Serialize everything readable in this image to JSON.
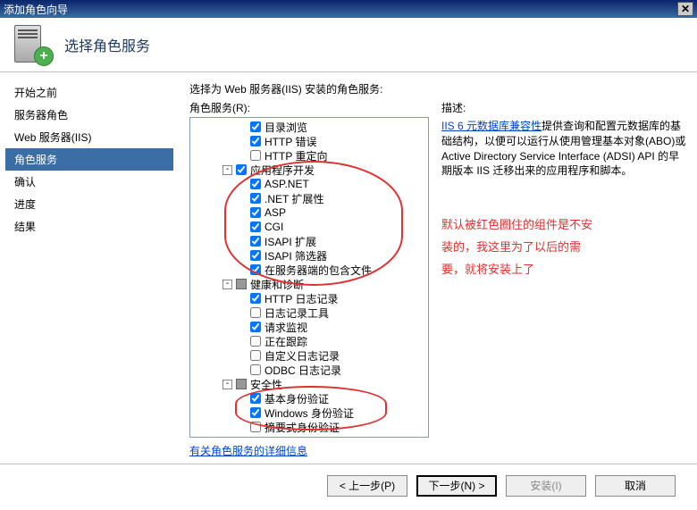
{
  "window": {
    "title": "添加角色向导",
    "close_glyph": "✕"
  },
  "header": {
    "title": "选择角色服务"
  },
  "nav": {
    "items": [
      {
        "label": "开始之前"
      },
      {
        "label": "服务器角色"
      },
      {
        "label": "Web 服务器(IIS)"
      },
      {
        "label": "角色服务",
        "active": true
      },
      {
        "label": "确认"
      },
      {
        "label": "进度"
      },
      {
        "label": "结果"
      }
    ]
  },
  "main": {
    "prompt": "选择为 Web 服务器(IIS) 安装的角色服务:",
    "role_label": "角色服务(R):",
    "tree": [
      {
        "indent": 3,
        "exp": "",
        "chk": "checked",
        "label": "目录浏览"
      },
      {
        "indent": 3,
        "exp": "",
        "chk": "checked",
        "label": "HTTP 错误"
      },
      {
        "indent": 3,
        "exp": "",
        "chk": "unchecked",
        "label": "HTTP 重定向"
      },
      {
        "indent": 2,
        "exp": "-",
        "chk": "checked",
        "label": "应用程序开发"
      },
      {
        "indent": 3,
        "exp": "",
        "chk": "checked",
        "label": "ASP.NET"
      },
      {
        "indent": 3,
        "exp": "",
        "chk": "checked",
        "label": ".NET 扩展性"
      },
      {
        "indent": 3,
        "exp": "",
        "chk": "checked",
        "label": "ASP"
      },
      {
        "indent": 3,
        "exp": "",
        "chk": "checked",
        "label": "CGI"
      },
      {
        "indent": 3,
        "exp": "",
        "chk": "checked",
        "label": "ISAPI 扩展"
      },
      {
        "indent": 3,
        "exp": "",
        "chk": "checked",
        "label": "ISAPI 筛选器"
      },
      {
        "indent": 3,
        "exp": "",
        "chk": "checked",
        "label": "在服务器端的包含文件"
      },
      {
        "indent": 2,
        "exp": "-",
        "chk": "tri",
        "label": "健康和诊断"
      },
      {
        "indent": 3,
        "exp": "",
        "chk": "checked",
        "label": "HTTP 日志记录"
      },
      {
        "indent": 3,
        "exp": "",
        "chk": "unchecked",
        "label": "日志记录工具"
      },
      {
        "indent": 3,
        "exp": "",
        "chk": "checked",
        "label": "请求监视"
      },
      {
        "indent": 3,
        "exp": "",
        "chk": "unchecked",
        "label": "正在跟踪"
      },
      {
        "indent": 3,
        "exp": "",
        "chk": "unchecked",
        "label": "自定义日志记录"
      },
      {
        "indent": 3,
        "exp": "",
        "chk": "unchecked",
        "label": "ODBC 日志记录"
      },
      {
        "indent": 2,
        "exp": "-",
        "chk": "tri",
        "label": "安全性"
      },
      {
        "indent": 3,
        "exp": "",
        "chk": "checked",
        "label": "基本身份验证"
      },
      {
        "indent": 3,
        "exp": "",
        "chk": "checked",
        "label": "Windows 身份验证"
      },
      {
        "indent": 3,
        "exp": "",
        "chk": "unchecked",
        "label": "摘要式身份验证"
      }
    ],
    "detail_link": "有关角色服务的详细信息"
  },
  "desc": {
    "title": "描述:",
    "link_text": "IIS 6 元数据库兼容性",
    "body_rest": "提供查询和配置元数据库的基础结构，以便可以运行从使用管理基本对象(ABO)或 Active Directory Service Interface (ADSI) API 的早期版本 IIS 迁移出来的应用程序和脚本。"
  },
  "annotation": {
    "line1": "默认被红色圈住的组件是不安",
    "line2": "装的，我这里为了以后的需",
    "line3": "要，就将安装上了"
  },
  "buttons": {
    "prev": "< 上一步(P)",
    "next": "下一步(N) >",
    "install": "安装(I)",
    "cancel": "取消"
  }
}
